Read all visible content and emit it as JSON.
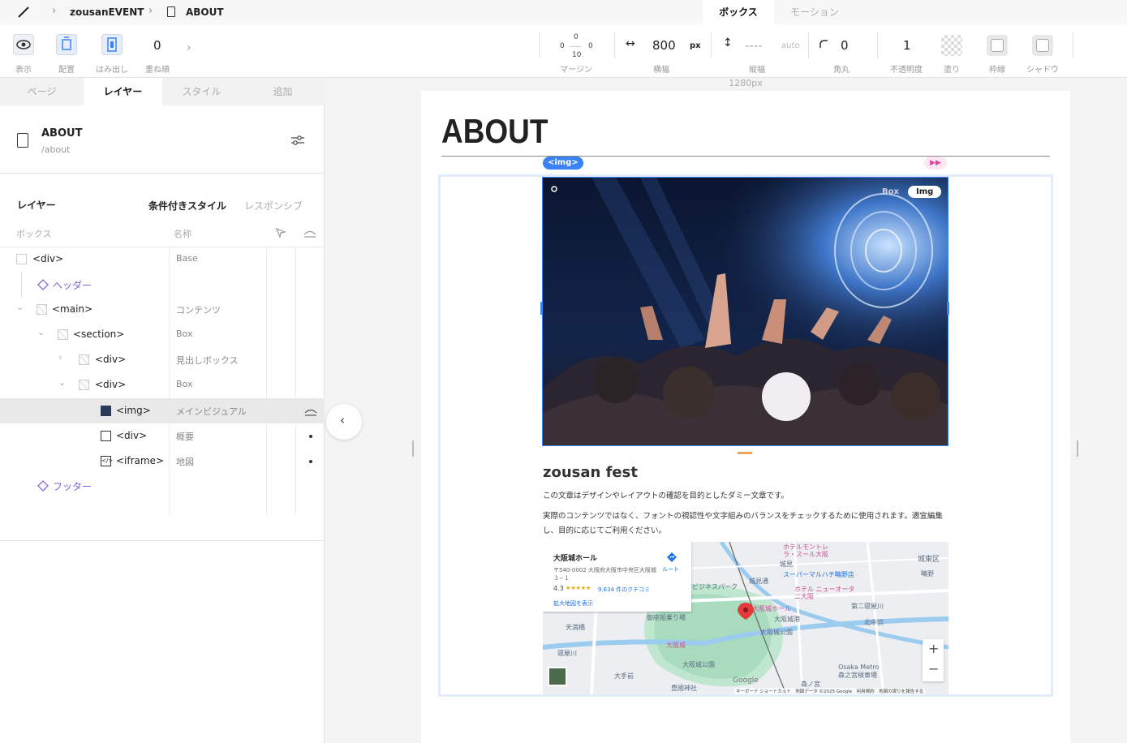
{
  "topbar": {
    "project": "zousanEVENT",
    "page": "ABOUT",
    "tabs": [
      {
        "label": "ボックス",
        "active": true
      },
      {
        "label": "モーション",
        "active": false
      }
    ]
  },
  "toolbar": {
    "left": [
      {
        "label": "表示",
        "icon": "eye-icon"
      },
      {
        "label": "配置",
        "icon": "layout-icon"
      },
      {
        "label": "はみ出し",
        "icon": "overflow-icon"
      },
      {
        "label": "重ね順",
        "value": "0"
      }
    ],
    "margin": {
      "label": "マージン",
      "top": "0",
      "left": "0",
      "right": "0",
      "bottom": "10"
    },
    "width": {
      "label": "横幅",
      "value": "800",
      "unit": "px"
    },
    "height": {
      "label": "縦幅",
      "value": "----",
      "unit": "auto"
    },
    "radius": {
      "label": "角丸",
      "value": "0"
    },
    "opacity": {
      "label": "不透明度",
      "value": "1"
    },
    "fill": {
      "label": "塗り"
    },
    "border": {
      "label": "枠線"
    },
    "shadow": {
      "label": "シャドウ"
    }
  },
  "panel": {
    "tabs": [
      {
        "label": "ページ"
      },
      {
        "label": "レイヤー",
        "active": true
      },
      {
        "label": "スタイル"
      },
      {
        "label": "追加"
      }
    ],
    "page_title": "ABOUT",
    "page_path": "/about",
    "layers_heading": "レイヤー",
    "cond_style": "条件付きスタイル",
    "responsive": "レスポンシブ",
    "col_box": "ボックス",
    "col_name": "名称",
    "rows": [
      {
        "tag": "<div>",
        "name": "Base"
      },
      {
        "tag": "ヘッダー",
        "name": ""
      },
      {
        "tag": "<main>",
        "name": "コンテンツ"
      },
      {
        "tag": "<section>",
        "name": "Box"
      },
      {
        "tag": "<div>",
        "name": "見出しボックス"
      },
      {
        "tag": "<div>",
        "name": "Box"
      },
      {
        "tag": "<img>",
        "name": "メインビジュアル"
      },
      {
        "tag": "<div>",
        "name": "概要"
      },
      {
        "tag": "<iframe>",
        "name": "地図"
      },
      {
        "tag": "フッター",
        "name": ""
      }
    ]
  },
  "canvas": {
    "ruler_label": "1280px",
    "heading": "ABOUT",
    "img_badge": "<img>",
    "box_chip": "Box",
    "img_chip": "Img",
    "event_title": "zousan fest",
    "desc1": "この文章はデザインやレイアウトの確認を目的としたダミー文章です。",
    "desc2": "実際のコンテンツではなく、フォントの視認性や文字組みのバランスをチェックするために使用されます。適宜編集し、目的に応じてご利用ください。"
  },
  "map": {
    "place_name": "大阪城ホール",
    "address": "〒540-0002 大阪府大阪市中央区大阪城３−１",
    "route": "ルート",
    "rating": "4.3",
    "stars": "★★★★★",
    "reviews": "9,634 件のクチコミ",
    "enlarge": "拡大地図を表示",
    "labels": [
      "城東区",
      "鴫野",
      "ビジネスパーク",
      "城見",
      "城見通",
      "大阪城ホール",
      "大阪城港",
      "大阪城公園",
      "天満橋",
      "大阪城",
      "大阪城公園",
      "大手前",
      "豊國神社",
      "森ノ宮",
      "Osaka Metro",
      "森之宮検車場",
      "寝屋川",
      "第二寝屋川",
      "スーパーマルハチ鴫野店",
      "ホテルモントレ ラ・スール大阪",
      "ホテル ニューオータニ大阪",
      "御座船乗り場",
      "北中浜"
    ],
    "footer": "キーボード ショートカット　地図データ ©2025 Google　利用規約　地図の誤りを報告する",
    "google": "Google",
    "zoom_in": "+",
    "zoom_out": "−"
  }
}
